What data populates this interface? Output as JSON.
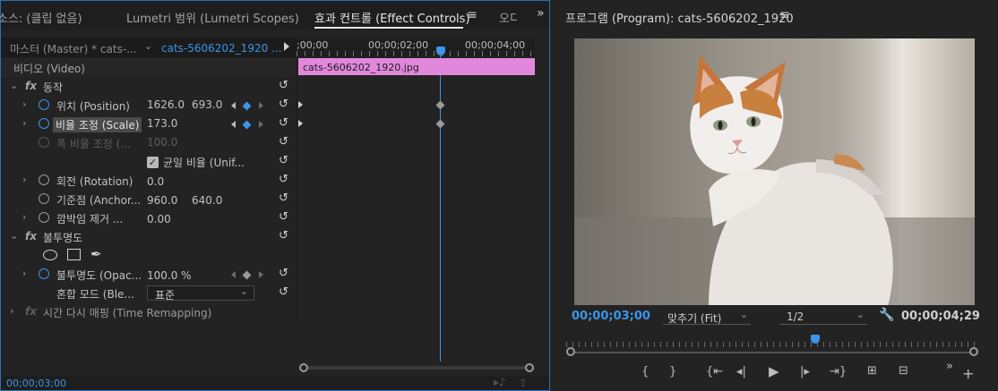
{
  "left_tabs": {
    "source": "소스: (클립 없음)",
    "lumetri": "Lumetri 범위 (Lumetri Scopes)",
    "effect_controls": "효과 컨트롤 (Effect Controls)",
    "audio": "오디"
  },
  "ec": {
    "master": "마스터 (Master) * cats-...",
    "clip": "cats-5606202_1920 ...",
    "ruler": [
      ";00;00",
      "00;00;02;00",
      "00;00;04;00"
    ],
    "clip_bar": "cats-5606202_1920.jpg",
    "video": "비디오 (Video)",
    "motion": "동작",
    "position_label": "위치 (Position)",
    "position_x": "1626.0",
    "position_y": "693.0",
    "scale_label": "비율 조정 (Scale)",
    "scale_value": "173.0",
    "scale_width_label": "폭 비율 조정 (...",
    "scale_width_value": "100.0",
    "uniform_label": "균일 비율 (Unif...",
    "rotation_label": "회전 (Rotation)",
    "rotation_value": "0.0",
    "anchor_label": "기준점 (Anchor...",
    "anchor_x": "960.0",
    "anchor_y": "640.0",
    "flicker_label": "깜박임 제거 ...",
    "flicker_value": "0.00",
    "opacity": "불투명도",
    "opacity_label": "불투명도 (Opac...",
    "opacity_value": "100.0 %",
    "blend_label": "혼합 모드 (Ble...",
    "blend_value": "표준",
    "time_remap": "시간 다시 매핑 (Time Remapping)",
    "fx": "fx",
    "timecode": "00;00;03;00"
  },
  "program": {
    "title": "프로그램 (Program): cats-5606202_1920",
    "timecode": "00;00;03;00",
    "fit": "맞추기 (Fit)",
    "resolution": "1/2",
    "duration": "00;00;04;29"
  },
  "colors": {
    "accent": "#3b95e8",
    "clip": "#e288dc",
    "panel": "#232323"
  }
}
